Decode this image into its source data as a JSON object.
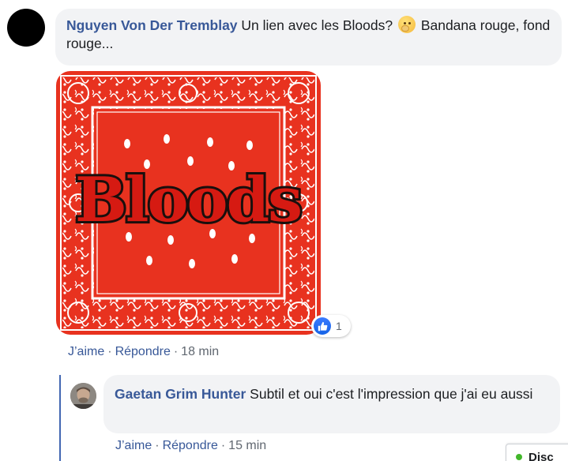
{
  "comment1": {
    "author": "Nguyen Von Der Tremblay",
    "text_before_emoji": "Un lien avec les Bloods?",
    "emoji_icon": "thinking-face-emoji",
    "text_after_emoji": "Bandana rouge, fond rouge...",
    "attachment": {
      "caption_text": "Bloods",
      "background_color": "#e8321f"
    },
    "reaction": {
      "icon": "like-icon",
      "count": "1"
    },
    "actions": {
      "like": "J’aime",
      "reply": "Répondre",
      "time": "18 min"
    }
  },
  "reply1": {
    "author": "Gaetan Grim Hunter",
    "text": "Subtil et oui c'est l'impression que j'ai eu aussi",
    "actions": {
      "like": "J’aime",
      "reply": "Répondre",
      "time": "15 min"
    }
  },
  "chat_tab": {
    "label": "Disc"
  },
  "colors": {
    "link": "#385898",
    "bubble": "#f2f3f5",
    "thread_line": "#4267b2",
    "meta_text": "#606770"
  }
}
